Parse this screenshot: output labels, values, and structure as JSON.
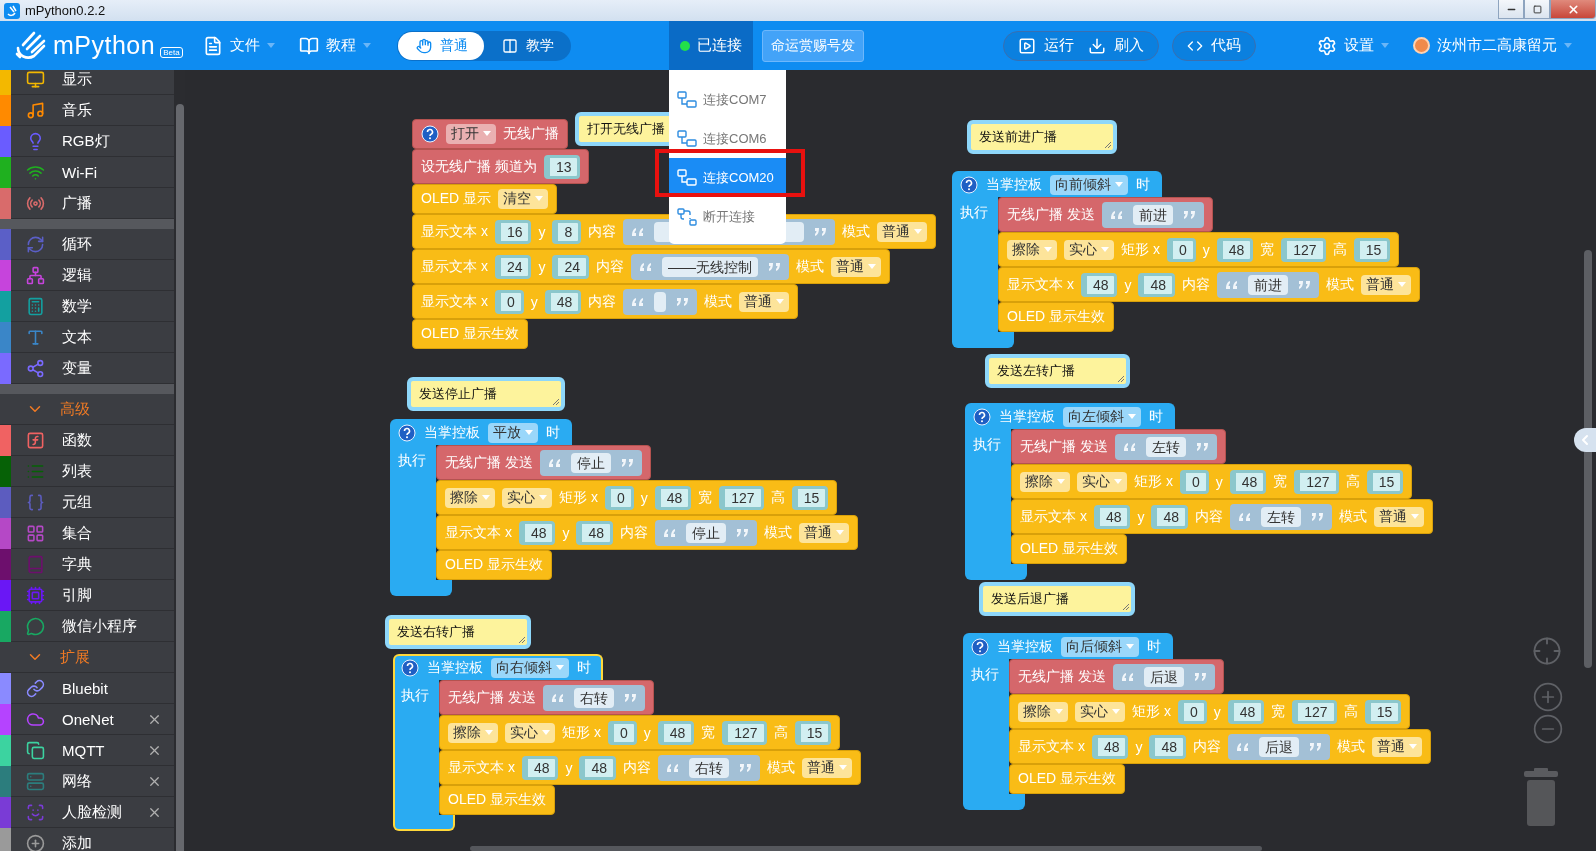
{
  "title_bar": {
    "title": "mPython0.2.2"
  },
  "toolbar": {
    "logo": "mPython",
    "badge": "Beta",
    "menus": [
      {
        "label": "文件"
      },
      {
        "label": "教程"
      }
    ],
    "modes": [
      {
        "label": "普通",
        "selected": true
      },
      {
        "label": "教学",
        "selected": false
      }
    ],
    "connection": {
      "label": "已连接",
      "connected": true
    },
    "device_button": "命运赏赐号发",
    "actions": [
      {
        "label": "运行"
      },
      {
        "label": "刷入"
      }
    ],
    "code_button": "代码",
    "settings": "设置",
    "user": "汝州市二高康留元"
  },
  "connection_menu": {
    "items": [
      {
        "kind": "port",
        "label": "连接COM7",
        "selected": false,
        "highlighted": false
      },
      {
        "kind": "port",
        "label": "连接COM6",
        "selected": false,
        "highlighted": false
      },
      {
        "kind": "port",
        "label": "连接COM20",
        "selected": true,
        "highlighted": true
      },
      {
        "kind": "disconnect",
        "label": "断开连接",
        "selected": false,
        "highlighted": false
      }
    ]
  },
  "sidebar": {
    "sections": [
      {
        "items": [
          {
            "label": "显示",
            "color": "#f3b800",
            "closable": false
          },
          {
            "label": "音乐",
            "color": "#ff8a00",
            "closable": false
          },
          {
            "label": "RGB灯",
            "color": "#6a5cff",
            "closable": false
          },
          {
            "label": "Wi-Fi",
            "color": "#1fb01f",
            "closable": false
          },
          {
            "label": "广播",
            "color": "#d96b6b",
            "closable": false
          }
        ]
      },
      {
        "items": [
          {
            "label": "循环",
            "color": "#5b5fc7",
            "closable": false
          },
          {
            "label": "逻辑",
            "color": "#c644dc",
            "closable": false
          },
          {
            "label": "数学",
            "color": "#13a0a0",
            "closable": false
          },
          {
            "label": "文本",
            "color": "#3a86c8",
            "closable": false
          },
          {
            "label": "变量",
            "color": "#7a6aff",
            "closable": false
          }
        ]
      },
      {
        "header": {
          "label": "高级",
          "expanded": true
        },
        "items": [
          {
            "label": "函数",
            "color": "#f06262",
            "closable": false
          },
          {
            "label": "列表",
            "color": "#066106",
            "closable": false
          },
          {
            "label": "元组",
            "color": "#5c5cbf",
            "closable": false
          },
          {
            "label": "集合",
            "color": "#b548c6",
            "closable": false
          },
          {
            "label": "字典",
            "color": "#6d0f6d",
            "closable": false
          },
          {
            "label": "引脚",
            "color": "#6a17f5",
            "closable": false
          },
          {
            "label": "微信小程序",
            "color": "#18a862",
            "closable": false
          }
        ]
      },
      {
        "header": {
          "label": "扩展",
          "expanded": true
        },
        "items": [
          {
            "label": "Bluebit",
            "color": "#8a8aff",
            "closable": false
          },
          {
            "label": "OneNet",
            "color": "#b543ff",
            "closable": true
          },
          {
            "label": "MQTT",
            "color": "#3cd3a0",
            "closable": true
          },
          {
            "label": "网络",
            "color": "#2c7d7d",
            "closable": true
          },
          {
            "label": "人脸检测",
            "color": "#7a3bd6",
            "closable": true
          },
          {
            "label": "添加",
            "color": "#9a9a9a",
            "closable": false
          }
        ]
      }
    ]
  },
  "block_groups": [
    {
      "kind": "stack",
      "selected": false,
      "comment": "打开无线广播",
      "blocks": [
        {
          "kind": "radio",
          "parts": [
            {
              "kind": "dropdown",
              "text": "打开"
            },
            {
              "kind": "label",
              "text": "无线广播"
            }
          ]
        },
        {
          "kind": "radio",
          "parts": [
            {
              "kind": "label",
              "text": "设无线广播 频道为"
            },
            {
              "kind": "number",
              "text": "13"
            }
          ]
        },
        {
          "kind": "oled",
          "parts": [
            {
              "kind": "label",
              "text": "OLED 显示"
            },
            {
              "kind": "dropdown",
              "text": "清空"
            }
          ]
        },
        {
          "kind": "oled",
          "parts": [
            {
              "kind": "label",
              "text": "显示文本 x"
            },
            {
              "kind": "number",
              "text": "16"
            },
            {
              "kind": "label",
              "text": "y"
            },
            {
              "kind": "number",
              "text": "8"
            },
            {
              "kind": "label",
              "text": "内容"
            },
            {
              "kind": "string"
            },
            {
              "kind": "label",
              "text": "模式"
            },
            {
              "kind": "dropdown",
              "text": "普通"
            }
          ]
        },
        {
          "kind": "oled",
          "parts": [
            {
              "kind": "label",
              "text": "显示文本 x"
            },
            {
              "kind": "number",
              "text": "24"
            },
            {
              "kind": "label",
              "text": "y"
            },
            {
              "kind": "number",
              "text": "24"
            },
            {
              "kind": "label",
              "text": "内容"
            },
            {
              "kind": "string",
              "text": "——无线控制"
            },
            {
              "kind": "label",
              "text": "模式"
            },
            {
              "kind": "dropdown",
              "text": "普通"
            }
          ]
        },
        {
          "kind": "oled",
          "parts": [
            {
              "kind": "label",
              "text": "显示文本 x"
            },
            {
              "kind": "number",
              "text": "0"
            },
            {
              "kind": "label",
              "text": "y"
            },
            {
              "kind": "number",
              "text": "48"
            },
            {
              "kind": "label",
              "text": "内容"
            },
            {
              "kind": "string"
            },
            {
              "kind": "label",
              "text": "模式"
            },
            {
              "kind": "dropdown",
              "text": "普通"
            }
          ]
        },
        {
          "kind": "oled",
          "parts": [
            {
              "kind": "label",
              "text": "OLED 显示生效"
            }
          ]
        }
      ]
    },
    {
      "kind": "event",
      "selected": false,
      "comment": "发送前进广播",
      "hat": [
        {
          "kind": "label",
          "text": "当掌控板"
        },
        {
          "kind": "dropdown",
          "text": "向前倾斜"
        },
        {
          "kind": "label",
          "text": "时"
        }
      ],
      "body_label": "执行",
      "blocks": [
        {
          "kind": "radio",
          "parts": [
            {
              "kind": "label",
              "text": "无线广播 发送"
            },
            {
              "kind": "string",
              "text": "前进"
            }
          ]
        },
        {
          "kind": "oled",
          "parts": [
            {
              "kind": "dropdown",
              "text": "擦除"
            },
            {
              "kind": "dropdown",
              "text": "实心"
            },
            {
              "kind": "label",
              "text": "矩形 x"
            },
            {
              "kind": "number",
              "text": "0"
            },
            {
              "kind": "label",
              "text": "y"
            },
            {
              "kind": "number",
              "text": "48"
            },
            {
              "kind": "label",
              "text": "宽"
            },
            {
              "kind": "number",
              "text": "127"
            },
            {
              "kind": "label",
              "text": "高"
            },
            {
              "kind": "number",
              "text": "15"
            }
          ]
        },
        {
          "kind": "oled",
          "parts": [
            {
              "kind": "label",
              "text": "显示文本 x"
            },
            {
              "kind": "number",
              "text": "48"
            },
            {
              "kind": "label",
              "text": "y"
            },
            {
              "kind": "number",
              "text": "48"
            },
            {
              "kind": "label",
              "text": "内容"
            },
            {
              "kind": "string",
              "text": "前进"
            },
            {
              "kind": "label",
              "text": "模式"
            },
            {
              "kind": "dropdown",
              "text": "普通"
            }
          ]
        },
        {
          "kind": "oled",
          "parts": [
            {
              "kind": "label",
              "text": "OLED 显示生效"
            }
          ]
        }
      ]
    },
    {
      "kind": "event",
      "selected": false,
      "comment": "发送停止广播",
      "hat": [
        {
          "kind": "label",
          "text": "当掌控板"
        },
        {
          "kind": "dropdown",
          "text": "平放"
        },
        {
          "kind": "label",
          "text": "时"
        }
      ],
      "body_label": "执行",
      "blocks": [
        {
          "kind": "radio",
          "parts": [
            {
              "kind": "label",
              "text": "无线广播 发送"
            },
            {
              "kind": "string",
              "text": "停止"
            }
          ]
        },
        {
          "kind": "oled",
          "parts": [
            {
              "kind": "dropdown",
              "text": "擦除"
            },
            {
              "kind": "dropdown",
              "text": "实心"
            },
            {
              "kind": "label",
              "text": "矩形 x"
            },
            {
              "kind": "number",
              "text": "0"
            },
            {
              "kind": "label",
              "text": "y"
            },
            {
              "kind": "number",
              "text": "48"
            },
            {
              "kind": "label",
              "text": "宽"
            },
            {
              "kind": "number",
              "text": "127"
            },
            {
              "kind": "label",
              "text": "高"
            },
            {
              "kind": "number",
              "text": "15"
            }
          ]
        },
        {
          "kind": "oled",
          "parts": [
            {
              "kind": "label",
              "text": "显示文本 x"
            },
            {
              "kind": "number",
              "text": "48"
            },
            {
              "kind": "label",
              "text": "y"
            },
            {
              "kind": "number",
              "text": "48"
            },
            {
              "kind": "label",
              "text": "内容"
            },
            {
              "kind": "string",
              "text": "停止"
            },
            {
              "kind": "label",
              "text": "模式"
            },
            {
              "kind": "dropdown",
              "text": "普通"
            }
          ]
        },
        {
          "kind": "oled",
          "parts": [
            {
              "kind": "label",
              "text": "OLED 显示生效"
            }
          ]
        }
      ]
    },
    {
      "kind": "event",
      "selected": false,
      "comment": "发送左转广播",
      "hat": [
        {
          "kind": "label",
          "text": "当掌控板"
        },
        {
          "kind": "dropdown",
          "text": "向左倾斜"
        },
        {
          "kind": "label",
          "text": "时"
        }
      ],
      "body_label": "执行",
      "blocks": [
        {
          "kind": "radio",
          "parts": [
            {
              "kind": "label",
              "text": "无线广播 发送"
            },
            {
              "kind": "string",
              "text": "左转"
            }
          ]
        },
        {
          "kind": "oled",
          "parts": [
            {
              "kind": "dropdown",
              "text": "擦除"
            },
            {
              "kind": "dropdown",
              "text": "实心"
            },
            {
              "kind": "label",
              "text": "矩形 x"
            },
            {
              "kind": "number",
              "text": "0"
            },
            {
              "kind": "label",
              "text": "y"
            },
            {
              "kind": "number",
              "text": "48"
            },
            {
              "kind": "label",
              "text": "宽"
            },
            {
              "kind": "number",
              "text": "127"
            },
            {
              "kind": "label",
              "text": "高"
            },
            {
              "kind": "number",
              "text": "15"
            }
          ]
        },
        {
          "kind": "oled",
          "parts": [
            {
              "kind": "label",
              "text": "显示文本 x"
            },
            {
              "kind": "number",
              "text": "48"
            },
            {
              "kind": "label",
              "text": "y"
            },
            {
              "kind": "number",
              "text": "48"
            },
            {
              "kind": "label",
              "text": "内容"
            },
            {
              "kind": "string",
              "text": "左转"
            },
            {
              "kind": "label",
              "text": "模式"
            },
            {
              "kind": "dropdown",
              "text": "普通"
            }
          ]
        },
        {
          "kind": "oled",
          "parts": [
            {
              "kind": "label",
              "text": "OLED 显示生效"
            }
          ]
        }
      ]
    },
    {
      "kind": "event",
      "selected": true,
      "comment": "发送右转广播",
      "hat": [
        {
          "kind": "label",
          "text": "当掌控板"
        },
        {
          "kind": "dropdown",
          "text": "向右倾斜"
        },
        {
          "kind": "label",
          "text": "时"
        }
      ],
      "body_label": "执行",
      "blocks": [
        {
          "kind": "radio",
          "parts": [
            {
              "kind": "label",
              "text": "无线广播 发送"
            },
            {
              "kind": "string",
              "text": "右转"
            }
          ]
        },
        {
          "kind": "oled",
          "parts": [
            {
              "kind": "dropdown",
              "text": "擦除"
            },
            {
              "kind": "dropdown",
              "text": "实心"
            },
            {
              "kind": "label",
              "text": "矩形 x"
            },
            {
              "kind": "number",
              "text": "0"
            },
            {
              "kind": "label",
              "text": "y"
            },
            {
              "kind": "number",
              "text": "48"
            },
            {
              "kind": "label",
              "text": "宽"
            },
            {
              "kind": "number",
              "text": "127"
            },
            {
              "kind": "label",
              "text": "高"
            },
            {
              "kind": "number",
              "text": "15"
            }
          ]
        },
        {
          "kind": "oled",
          "parts": [
            {
              "kind": "label",
              "text": "显示文本 x"
            },
            {
              "kind": "number",
              "text": "48"
            },
            {
              "kind": "label",
              "text": "y"
            },
            {
              "kind": "number",
              "text": "48"
            },
            {
              "kind": "label",
              "text": "内容"
            },
            {
              "kind": "string",
              "text": "右转"
            },
            {
              "kind": "label",
              "text": "模式"
            },
            {
              "kind": "dropdown",
              "text": "普通"
            }
          ]
        },
        {
          "kind": "oled",
          "parts": [
            {
              "kind": "label",
              "text": "OLED 显示生效"
            }
          ]
        }
      ]
    },
    {
      "kind": "event",
      "selected": false,
      "comment": "发送后退广播",
      "hat": [
        {
          "kind": "label",
          "text": "当掌控板"
        },
        {
          "kind": "dropdown",
          "text": "向后倾斜"
        },
        {
          "kind": "label",
          "text": "时"
        }
      ],
      "body_label": "执行",
      "blocks": [
        {
          "kind": "radio",
          "parts": [
            {
              "kind": "label",
              "text": "无线广播 发送"
            },
            {
              "kind": "string",
              "text": "后退"
            }
          ]
        },
        {
          "kind": "oled",
          "parts": [
            {
              "kind": "dropdown",
              "text": "擦除"
            },
            {
              "kind": "dropdown",
              "text": "实心"
            },
            {
              "kind": "label",
              "text": "矩形 x"
            },
            {
              "kind": "number",
              "text": "0"
            },
            {
              "kind": "label",
              "text": "y"
            },
            {
              "kind": "number",
              "text": "48"
            },
            {
              "kind": "label",
              "text": "宽"
            },
            {
              "kind": "number",
              "text": "127"
            },
            {
              "kind": "label",
              "text": "高"
            },
            {
              "kind": "number",
              "text": "15"
            }
          ]
        },
        {
          "kind": "oled",
          "parts": [
            {
              "kind": "label",
              "text": "显示文本 x"
            },
            {
              "kind": "number",
              "text": "48"
            },
            {
              "kind": "label",
              "text": "y"
            },
            {
              "kind": "number",
              "text": "48"
            },
            {
              "kind": "label",
              "text": "内容"
            },
            {
              "kind": "string",
              "text": "后退"
            },
            {
              "kind": "label",
              "text": "模式"
            },
            {
              "kind": "dropdown",
              "text": "普通"
            }
          ]
        },
        {
          "kind": "oled",
          "parts": [
            {
              "kind": "label",
              "text": "OLED 显示生效"
            }
          ]
        }
      ]
    }
  ]
}
